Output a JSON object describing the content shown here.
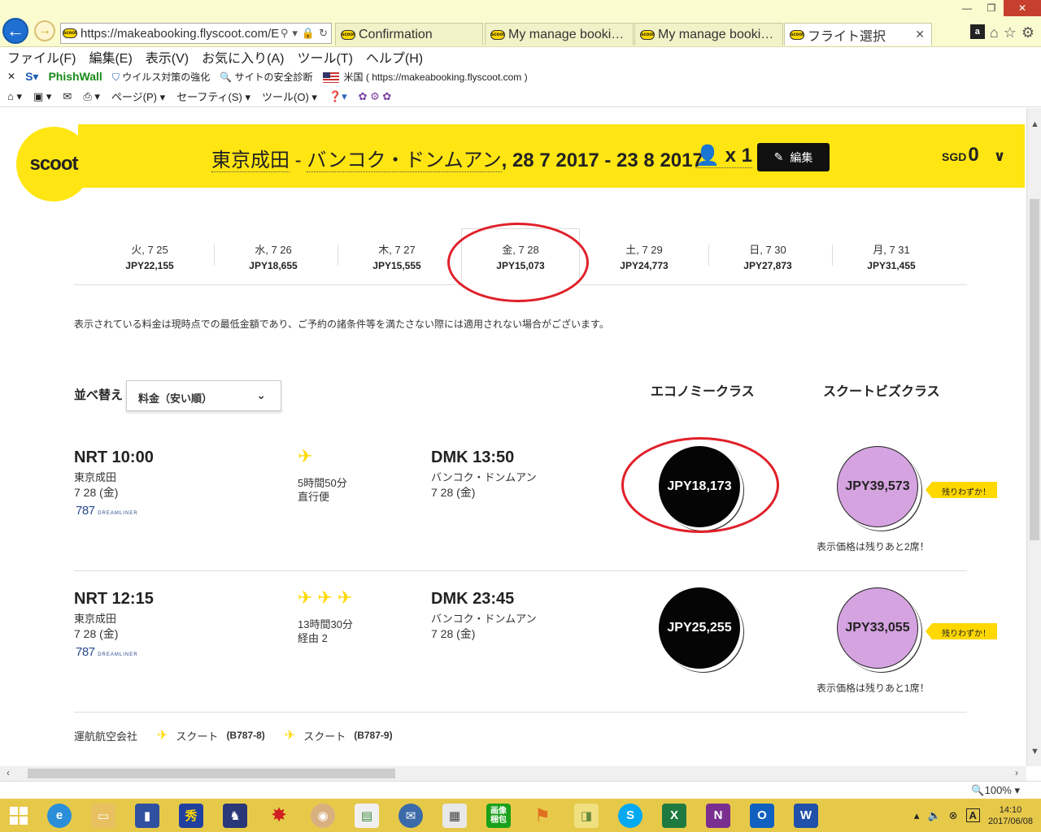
{
  "browser": {
    "url": "https://makeabooking.flyscoot.com/E",
    "tabs": [
      {
        "title": "Confirmation"
      },
      {
        "title": "My manage booki…"
      },
      {
        "title": "My manage booki…"
      },
      {
        "title": "フライト選択"
      }
    ],
    "menu": [
      "ファイル(F)",
      "編集(E)",
      "表示(V)",
      "お気に入り(A)",
      "ツール(T)",
      "ヘルプ(H)"
    ],
    "links": {
      "phishwall": "PhishWall",
      "virus": "ウイルス対策の強化",
      "safety": "サイトの安全診断",
      "country": "米国",
      "url_hint": "( https://makeabooking.flyscoot.com )"
    },
    "commands": [
      "ページ(P)",
      "セーフティ(S)",
      "ツール(O)"
    ],
    "zoom": "100%"
  },
  "header": {
    "logo": "scoot",
    "origin": "東京成田",
    "separator": "-",
    "destination": "バンコク・ドンムアン",
    "dates": ", 28 7 2017 - 23 8 2017",
    "pax": "x 1",
    "edit_label": "編集",
    "currency": "SGD",
    "amount": "0"
  },
  "date_tabs": [
    {
      "label": "火, 7 25",
      "price": "JPY22,155"
    },
    {
      "label": "水, 7 26",
      "price": "JPY18,655"
    },
    {
      "label": "木, 7 27",
      "price": "JPY15,555"
    },
    {
      "label": "金, 7 28",
      "price": "JPY15,073"
    },
    {
      "label": "土, 7 29",
      "price": "JPY24,773"
    },
    {
      "label": "日, 7 30",
      "price": "JPY27,873"
    },
    {
      "label": "月, 7 31",
      "price": "JPY31,455"
    }
  ],
  "selected_date_index": 3,
  "note": "表示されている料金は現時点での最低金額であり、ご予約の諸条件等を満たさない際には適用されない場合がございます。",
  "sort": {
    "label": "並べ替え",
    "value": "料金（安い順）"
  },
  "classes": {
    "economy": "エコノミークラス",
    "business": "スクートビズクラス"
  },
  "flights": [
    {
      "dep_time": "NRT 10:00",
      "dep_city": "東京成田",
      "dep_date": "7 28 (金)",
      "aircraft": "787",
      "aircraft_sub": "DREAMLINER",
      "duration": "5時間50分",
      "stops": "直行便",
      "arr_time": "DMK 13:50",
      "arr_city": "バンコク・ドンムアン",
      "arr_date": "7 28 (金)",
      "economy_price": "JPY18,173",
      "business_price": "JPY39,573",
      "tag": "残りわずか！",
      "seats_note": "表示価格は残りあと2席！"
    },
    {
      "dep_time": "NRT 12:15",
      "dep_city": "東京成田",
      "dep_date": "7 28 (金)",
      "aircraft": "787",
      "aircraft_sub": "DREAMLINER",
      "duration": "13時間30分",
      "stops": "経由 2",
      "arr_time": "DMK 23:45",
      "arr_city": "バンコク・ドンムアン",
      "arr_date": "7 28 (金)",
      "economy_price": "JPY25,255",
      "business_price": "JPY33,055",
      "tag": "残りわずか！",
      "seats_note": "表示価格は残りあと1席！"
    }
  ],
  "operated_by": {
    "label": "運航航空会社",
    "airline1": "スクート",
    "code1": "(B787-8)",
    "airline2": "スクート",
    "code2": "(B787-9)"
  },
  "taskbar": {
    "clock_time": "14:10",
    "clock_date": "2017/06/08"
  },
  "colors": {
    "brand_yellow": "#ffe512",
    "economy_bubble": "#050505",
    "business_bubble": "#d5a3e0",
    "highlight_oval": "#e0202a"
  }
}
